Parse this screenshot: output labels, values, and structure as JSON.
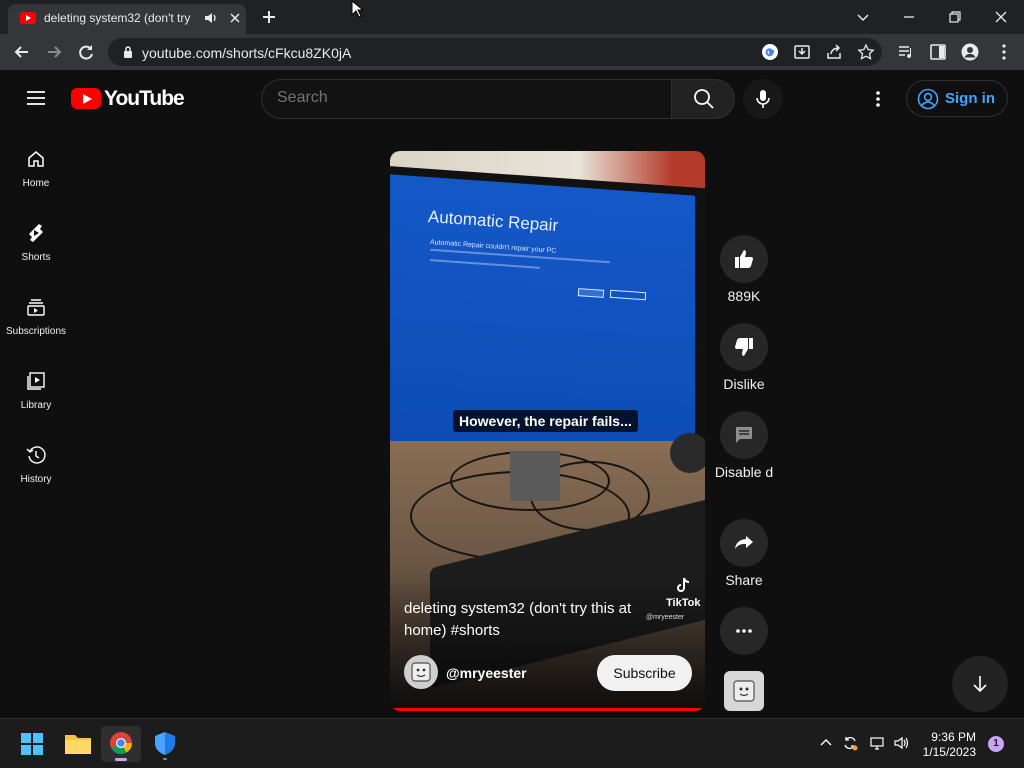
{
  "browser": {
    "tab_title": "deleting system32 (don't try",
    "url": "youtube.com/shorts/cFkcu8ZK0jA"
  },
  "header": {
    "logo_text": "YouTube",
    "search_placeholder": "Search",
    "signin_label": "Sign in"
  },
  "sidebar": {
    "items": [
      {
        "label": "Home",
        "icon": "home-icon"
      },
      {
        "label": "Shorts",
        "icon": "shorts-icon"
      },
      {
        "label": "Subscriptions",
        "icon": "subscriptions-icon"
      },
      {
        "label": "Library",
        "icon": "library-icon"
      },
      {
        "label": "History",
        "icon": "history-icon"
      }
    ]
  },
  "short": {
    "screen_title": "Automatic Repair",
    "screen_subtitle": "Automatic Repair couldn't repair your PC",
    "caption": "However, the repair fails...",
    "watermark": "TikTok",
    "watermark_user": "@mryeester",
    "title": "deleting system32 (don't try this at home) #shorts",
    "channel": "@mryeester",
    "subscribe_label": "Subscribe"
  },
  "actions": {
    "likes": "889K",
    "dislike_label": "Dislike",
    "comments_label": "Disable d",
    "share_label": "Share"
  },
  "taskbar": {
    "time": "9:36 PM",
    "date": "1/15/2023",
    "notification_count": "1"
  },
  "colors": {
    "background": "#0f0f0f",
    "youtube_red": "#ff0000",
    "link_blue": "#3ea6ff",
    "chrome_dark": "#202124"
  }
}
